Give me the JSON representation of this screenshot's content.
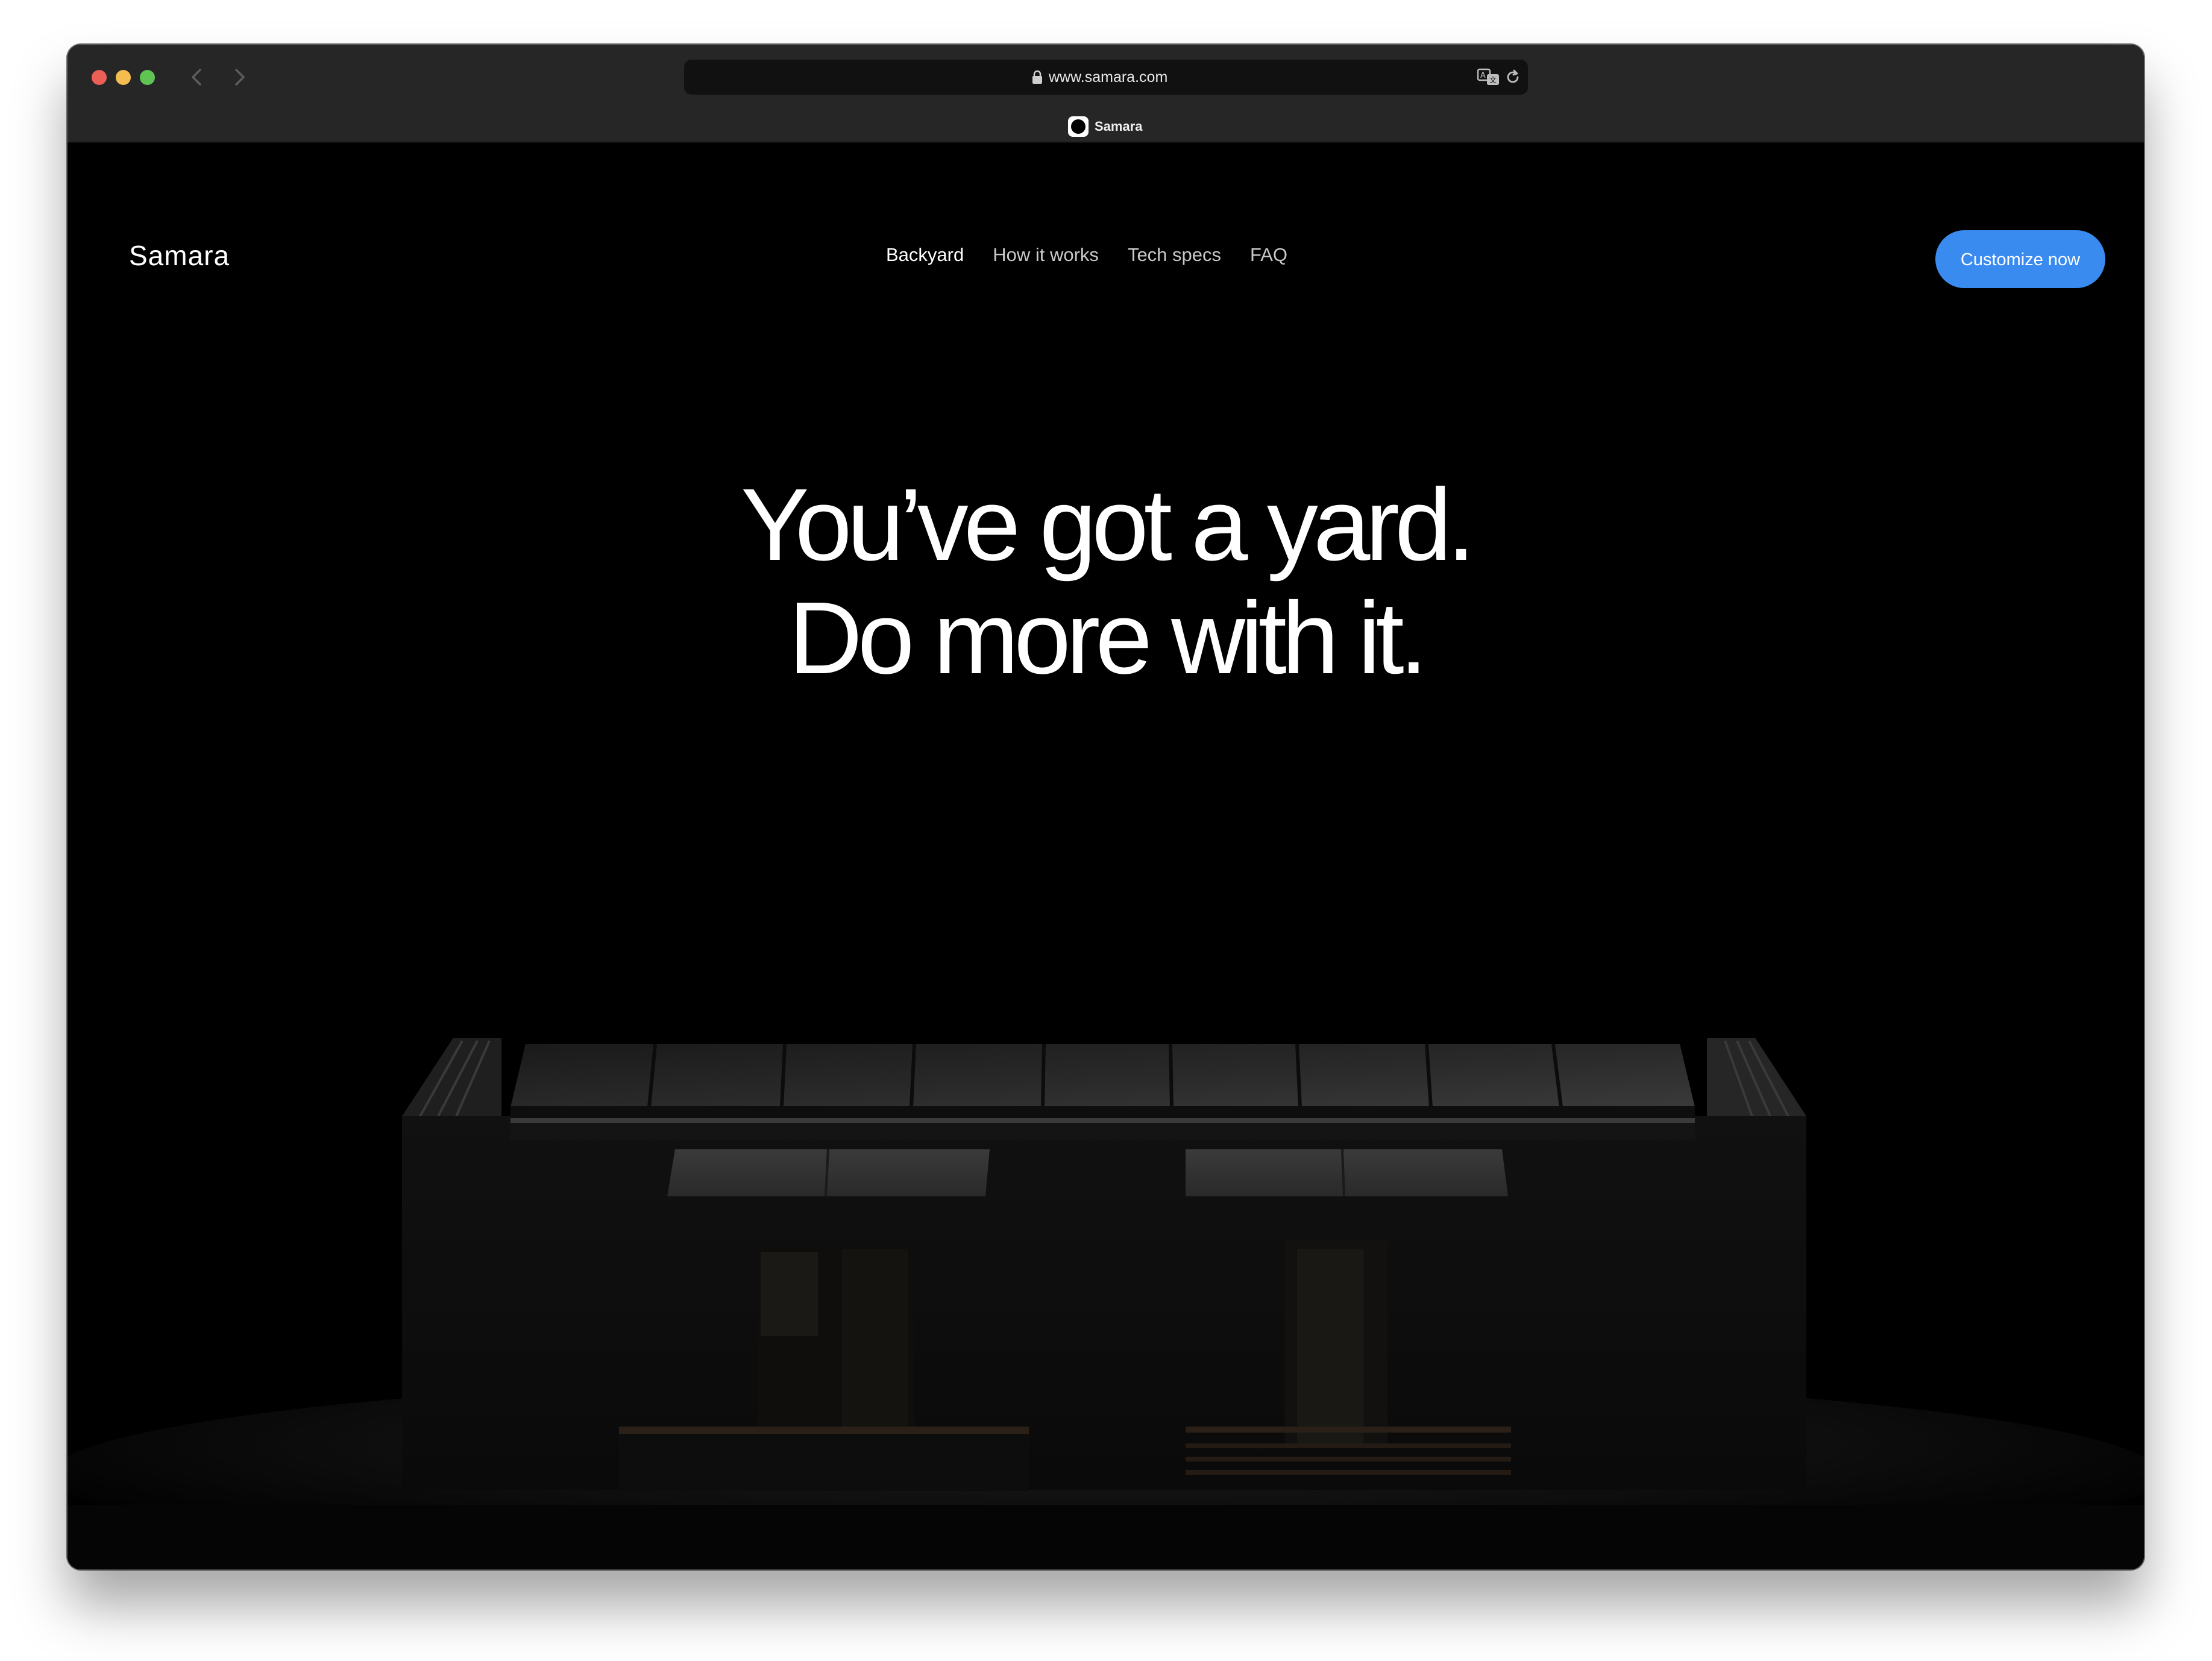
{
  "browser": {
    "url": "www.samara.com",
    "tab_title": "Samara",
    "icons": [
      "lock-icon",
      "translate-icon",
      "reload-icon",
      "back-arrow-icon",
      "forward-arrow-icon"
    ]
  },
  "site": {
    "logo": "Samara",
    "nav": [
      {
        "label": "Backyard",
        "active": true
      },
      {
        "label": "How it works",
        "active": false
      },
      {
        "label": "Tech specs",
        "active": false
      },
      {
        "label": "FAQ",
        "active": false
      }
    ],
    "cta_label": "Customize now",
    "accent_color": "#3a8bf0"
  },
  "hero": {
    "line1": "You’ve got a yard.",
    "line2": "Do more with it."
  }
}
